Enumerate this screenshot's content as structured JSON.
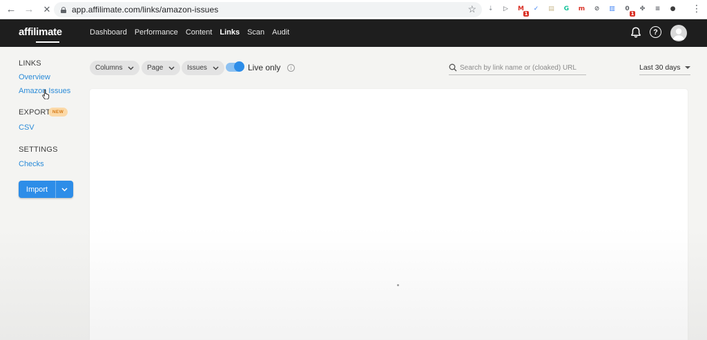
{
  "browser": {
    "url": "app.affilimate.com/links/amazon-issues",
    "back_icon": "←",
    "forward_icon": "→",
    "stop_icon": "✕",
    "bookmark_icon": "☆",
    "menu_icon": "⋮",
    "extensions": [
      {
        "name": "download-ext",
        "glyph": "⇣",
        "color": "#9aa0a6",
        "badge": ""
      },
      {
        "name": "play-ext",
        "glyph": "▷",
        "color": "#5f6368",
        "badge": ""
      },
      {
        "name": "red-ext",
        "glyph": "M",
        "color": "#d93025",
        "badge": "1"
      },
      {
        "name": "bolt-ext",
        "glyph": "✓",
        "color": "#4285f4",
        "badge": ""
      },
      {
        "name": "note-ext",
        "glyph": "▤",
        "color": "#c9b88e",
        "badge": ""
      },
      {
        "name": "grammarly-ext",
        "glyph": "G",
        "color": "#15c39a",
        "badge": ""
      },
      {
        "name": "m-ext",
        "glyph": "m",
        "color": "#d93025",
        "badge": ""
      },
      {
        "name": "compass-ext",
        "glyph": "⊘",
        "color": "#5f6368",
        "badge": ""
      },
      {
        "name": "chart-ext",
        "glyph": "▥",
        "color": "#4285f4",
        "badge": ""
      },
      {
        "name": "counter-ext",
        "glyph": "0",
        "color": "#5f6368",
        "badge": "1"
      },
      {
        "name": "puzzle-ext",
        "glyph": "✤",
        "color": "#5f6368",
        "badge": ""
      },
      {
        "name": "list-ext",
        "glyph": "≡",
        "color": "#5f6368",
        "badge": ""
      },
      {
        "name": "profile-ext",
        "glyph": "●",
        "color": "#3c3c3c",
        "badge": ""
      }
    ]
  },
  "app": {
    "logo": "affilimate",
    "nav": [
      "Dashboard",
      "Performance",
      "Content",
      "Links",
      "Scan",
      "Audit"
    ],
    "active_nav": "Links"
  },
  "sidebar": {
    "links_heading": "LINKS",
    "overview": "Overview",
    "amazon_issues": "Amazon Issues",
    "export_heading": "EXPORT",
    "new_badge": "NEW",
    "csv": "CSV",
    "settings_heading": "SETTINGS",
    "checks": "Checks",
    "import_label": "Import"
  },
  "filters": {
    "columns": "Columns",
    "page": "Page",
    "issues": "Issues",
    "live_only_label": "Live only",
    "live_only_on": true,
    "search_placeholder": "Search by link name or (cloaked) URL",
    "search_value": "",
    "date_range": "Last 30 days"
  },
  "colors": {
    "accent": "#2d8de8",
    "topbar": "#1e1e1e",
    "link": "#2a8bd8",
    "badge_bg": "#fbd9a8",
    "badge_text": "#d57a16"
  }
}
